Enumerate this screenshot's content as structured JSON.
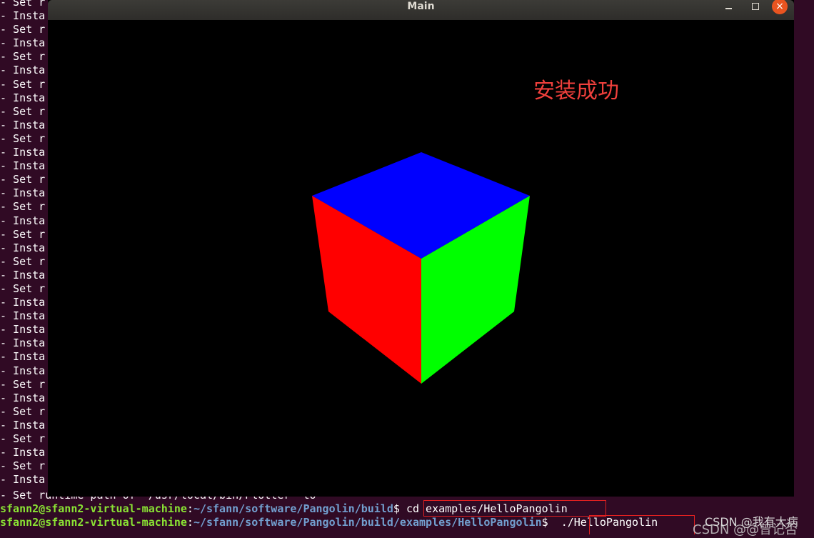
{
  "terminal": {
    "background": "#300a24",
    "install_lines": [
      "- Set r",
      "- Insta",
      "- Set r",
      "- Insta",
      "- Set r",
      "- Insta",
      "- Set r",
      "- Insta",
      "- Set r",
      "- Insta",
      "- Set r",
      "- Insta",
      "- Insta",
      "- Set r",
      "- Insta",
      "- Set r",
      "- Insta",
      "- Set r",
      "- Insta",
      "- Set r",
      "- Insta",
      "- Set r",
      "- Insta",
      "- Insta",
      "- Insta",
      "- Insta",
      "- Insta",
      "- Insta",
      "- Set r",
      "- Insta",
      "- Set r",
      "- Insta",
      "- Set r",
      "- Insta",
      "- Set r",
      "- Insta"
    ],
    "partial_line": "- Set runtime path of \"/usr/local/bin/Plotter\" to",
    "prompt1": {
      "user": "sfann2@sfann2-virtual-machine",
      "path": "~/sfann/software/Pangolin/build",
      "command": "cd examples/HelloPangolin"
    },
    "prompt2": {
      "user": "sfann2@sfann2-virtual-machine",
      "path": "~/sfann/software/Pangolin/build/examples/HelloPangolin",
      "command": "./HelloPangolin"
    },
    "user_color": "#8ae234",
    "path_color": "#729fcf"
  },
  "window": {
    "title": "Main",
    "min_icon": "minimize-icon",
    "max_icon": "maximize-icon",
    "close_icon": "close-icon",
    "close_glyph": "×",
    "close_color": "#e95420"
  },
  "viewport": {
    "label": "安装成功",
    "label_color": "#f0403c",
    "cube_faces": [
      {
        "name": "top",
        "color": "#0000ff"
      },
      {
        "name": "left",
        "color": "#ff0000"
      },
      {
        "name": "right",
        "color": "#00ff00"
      }
    ]
  },
  "watermark": {
    "primary": "CSDN @我有大病",
    "secondary": "CSDN @@曾记否"
  }
}
